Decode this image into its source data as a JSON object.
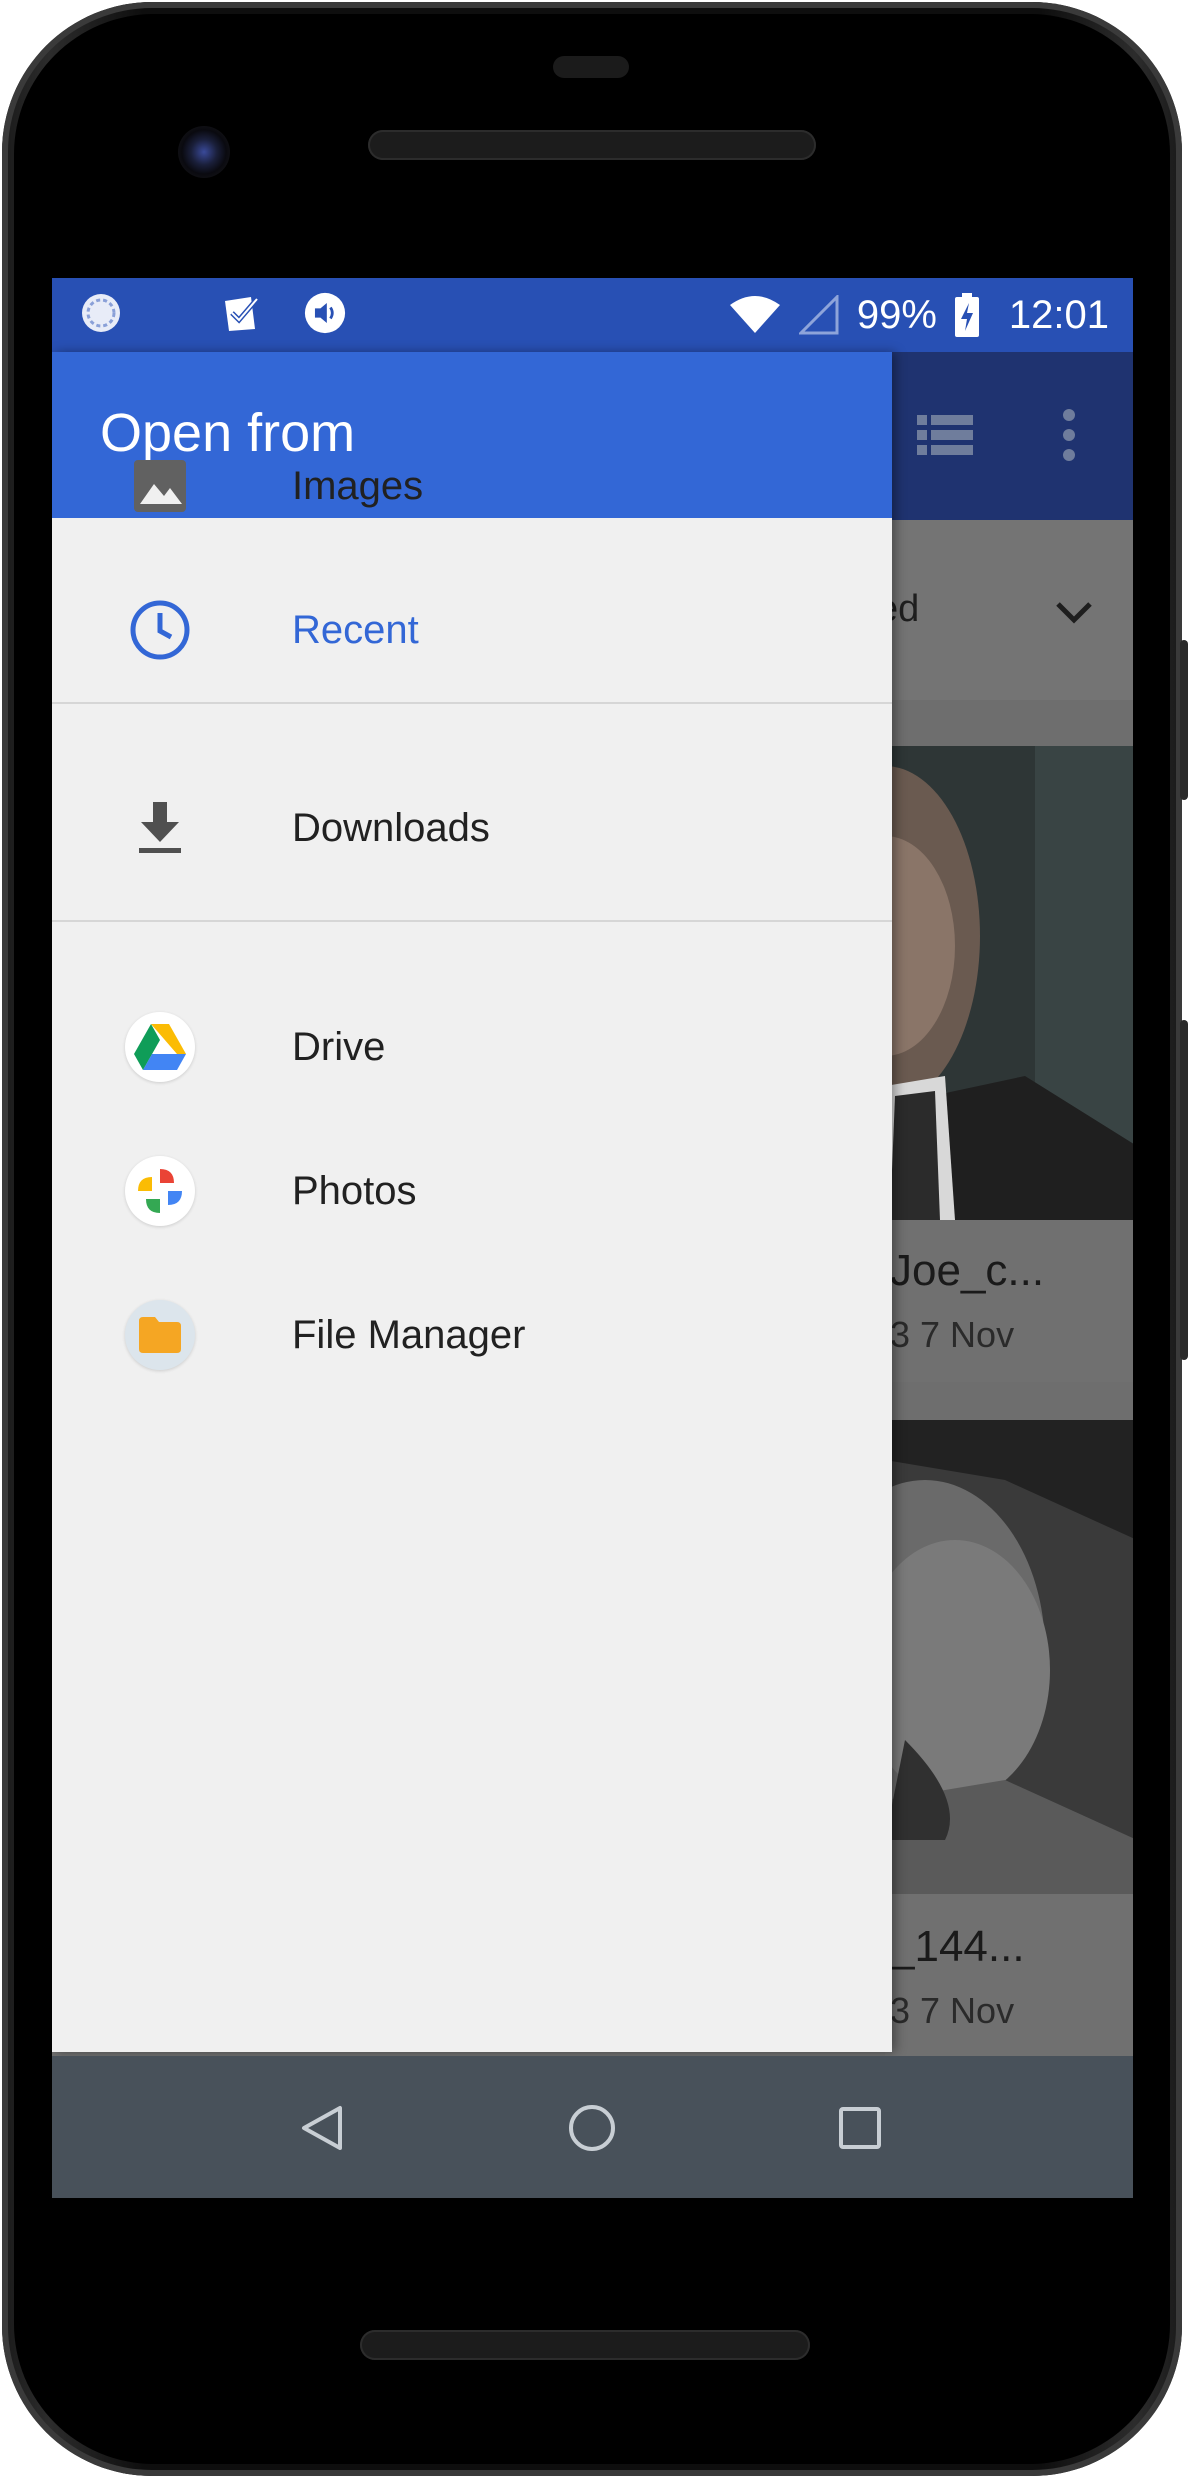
{
  "status_bar": {
    "battery": "99%",
    "time": "12:01",
    "icons": [
      "sync-icon",
      "task-check-icon",
      "volume-icon",
      "wifi-icon",
      "cell-signal-icon",
      "battery-charging-icon"
    ]
  },
  "drawer": {
    "title": "Open from",
    "items": [
      {
        "label": "Images",
        "icon": "image-icon",
        "active": false
      },
      {
        "label": "Recent",
        "icon": "clock-icon",
        "active": true
      },
      {
        "label": "Downloads",
        "icon": "download-icon",
        "active": false
      },
      {
        "label": "Drive",
        "icon": "drive-icon",
        "active": false
      },
      {
        "label": "Photos",
        "icon": "photos-icon",
        "active": false
      },
      {
        "label": "File Manager",
        "icon": "folder-icon",
        "active": false
      }
    ]
  },
  "background": {
    "sort_label_partial": "ed",
    "cards": [
      {
        "title_partial": "Joe_c...",
        "date_partial": "3 7 Nov"
      },
      {
        "title_partial": "_144...",
        "date_partial": "3 7 Nov"
      }
    ]
  },
  "colors": {
    "status_bar": "#2850b4",
    "drawer_header": "#3367d6",
    "active_item": "#3367d6",
    "nav_bar": "#48515a"
  }
}
